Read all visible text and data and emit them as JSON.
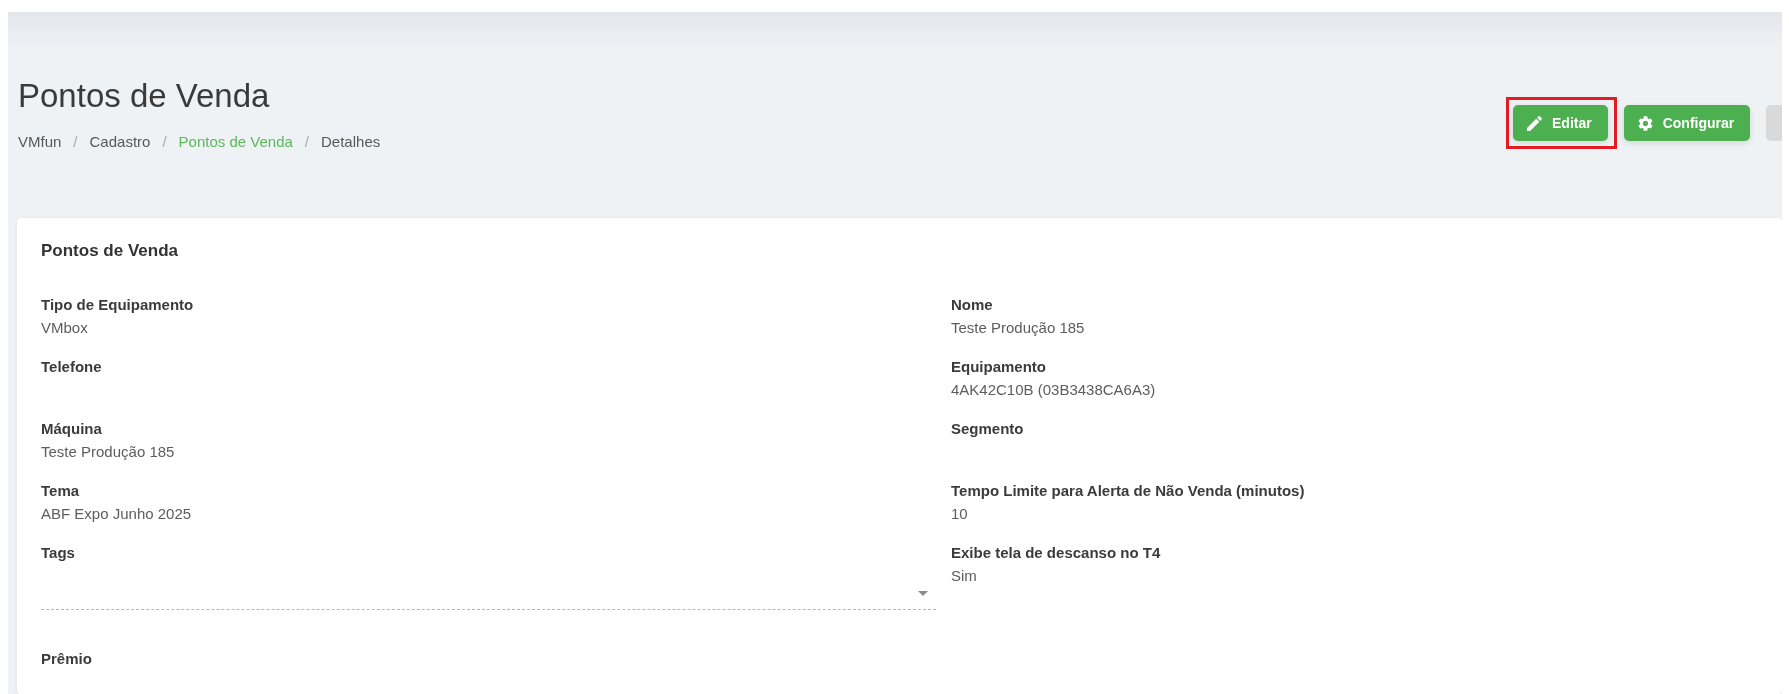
{
  "header": {
    "title": "Pontos de Venda",
    "breadcrumb": [
      {
        "label": "VMfun",
        "active": false
      },
      {
        "separator": "/",
        "label": "Cadastro",
        "active": false
      },
      {
        "separator": "/",
        "label": "Pontos de Venda",
        "active": true
      },
      {
        "separator": "/",
        "label": "Detalhes",
        "active": false
      }
    ],
    "buttons": [
      {
        "kind": "edit",
        "label": "Editar",
        "highlighted": true
      },
      {
        "kind": "settings",
        "label": "Configurar",
        "highlighted": false
      },
      {
        "kind": "secondary",
        "highlighted": false
      }
    ]
  },
  "card": {
    "title": "Pontos de Venda",
    "fields": [
      {
        "kind": "text",
        "label": "Tipo de Equipamento",
        "value": "VMbox"
      },
      {
        "kind": "text",
        "label": "Nome",
        "value": "Teste Produção 185"
      },
      {
        "kind": "text",
        "label": "Telefone"
      },
      {
        "kind": "text",
        "label": "Equipamento",
        "value": "4AK42C10B (03B3438CA6A3)"
      },
      {
        "kind": "text",
        "label": "Máquina",
        "value": "Teste Produção 185"
      },
      {
        "kind": "text",
        "label": "Segmento"
      },
      {
        "kind": "text",
        "label": "Tema",
        "value": "ABF Expo Junho 2025"
      },
      {
        "kind": "text",
        "label": "Tempo Limite para Alerta de Não Venda (minutos)",
        "value": "10"
      },
      {
        "kind": "select",
        "label": "Tags"
      },
      {
        "kind": "text",
        "label": "Exibe tela de descanso no T4",
        "value": "Sim"
      },
      {
        "kind": "text",
        "label": "Prêmio"
      }
    ]
  }
}
